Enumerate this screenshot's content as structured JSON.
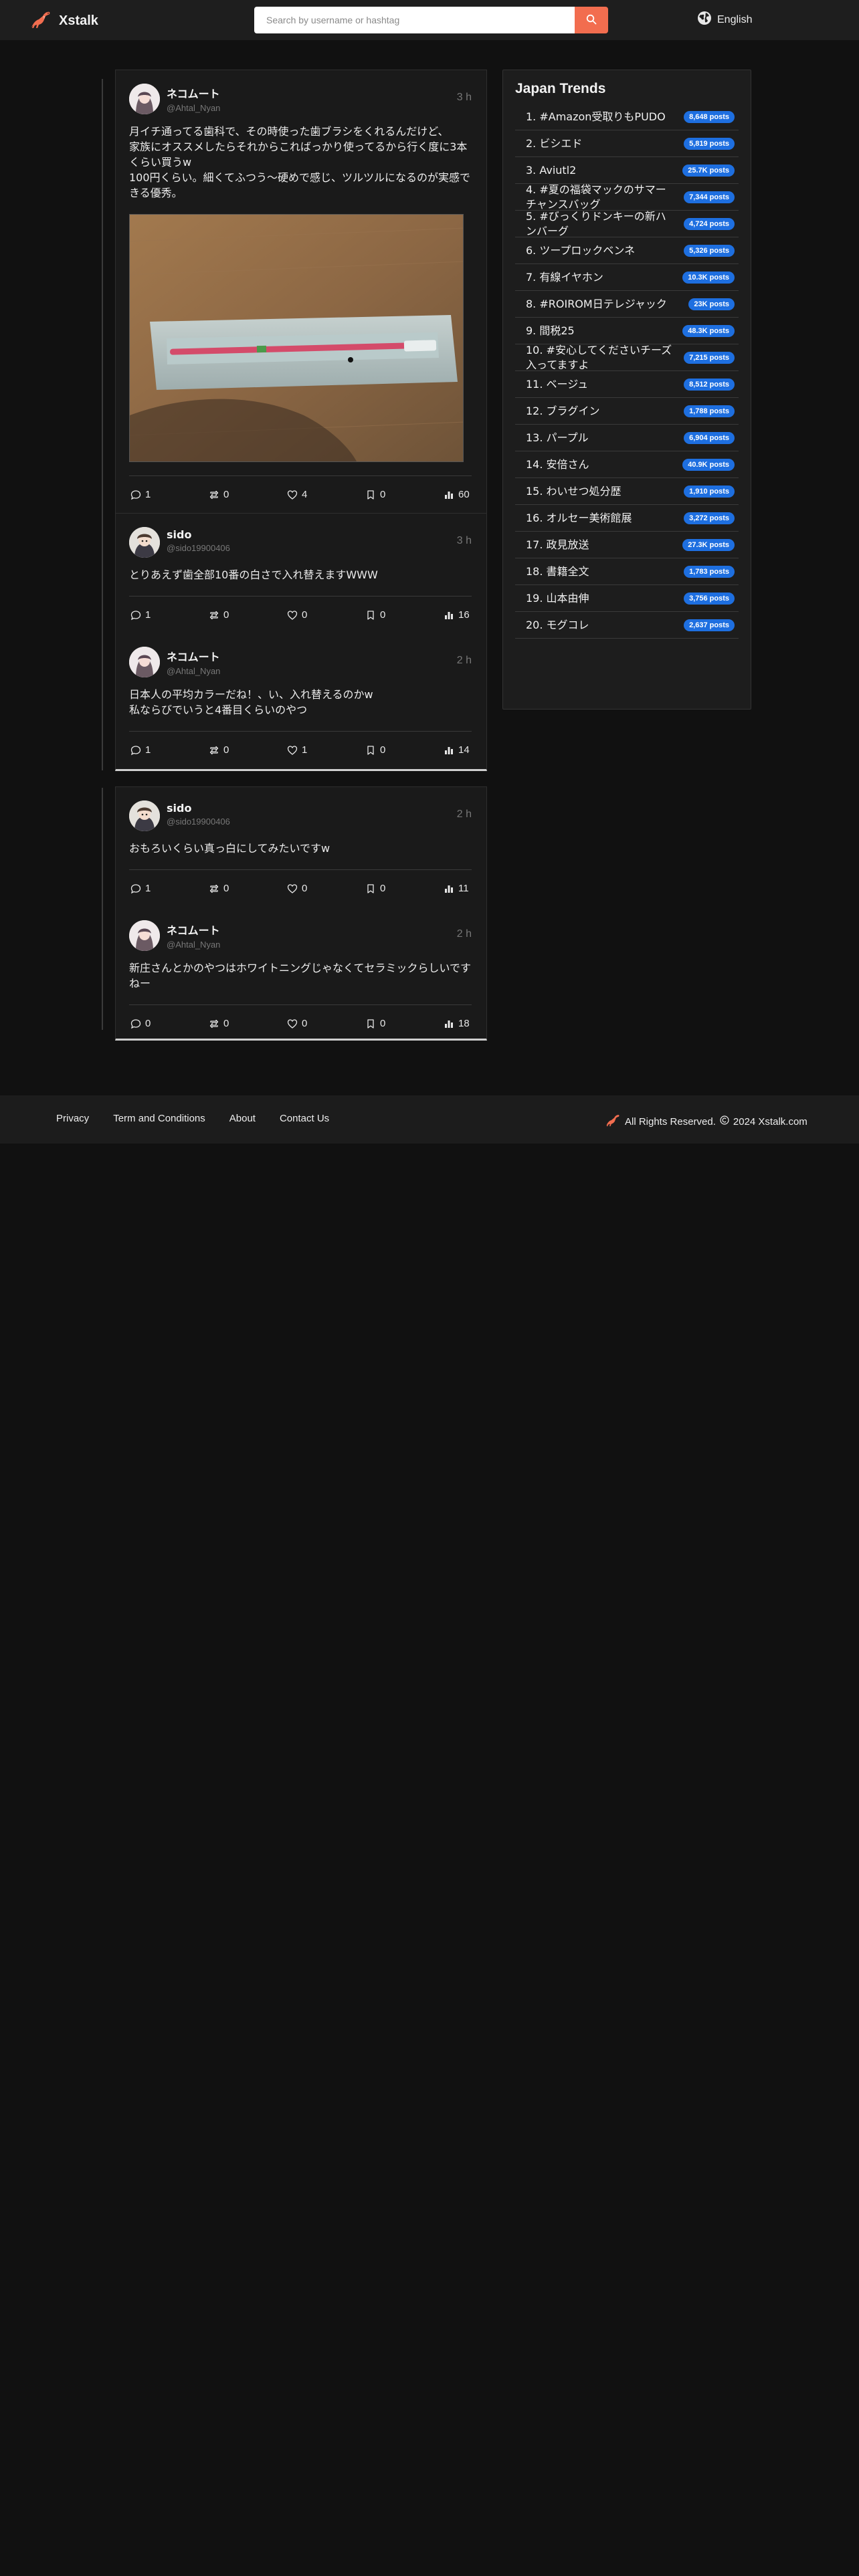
{
  "header": {
    "brand": "Xstalk",
    "search_placeholder": "Search by username or hashtag",
    "language": "English"
  },
  "threads": [
    {
      "posts": [
        {
          "name": "ネコムート",
          "handle": "@Ahtal_Nyan",
          "time": "3 h",
          "text": "月イチ通ってる歯科で、その時使った歯ブラシをくれるんだけど、\n家族にオススメしたらそれからこればっかり使ってるから行く度に3本くらい買うw\n100円くらい。細くてふつう〜硬めで感じ、ツルツルになるのが実感できる優秀。",
          "has_image": true,
          "comments": "1",
          "reposts": "0",
          "likes": "4",
          "bookmarks": "0",
          "views": "60"
        },
        {
          "name": "sido",
          "handle": "@sido19900406",
          "time": "3 h",
          "text": "とりあえず歯全部10番の白さで入れ替えますWWW",
          "has_image": false,
          "comments": "1",
          "reposts": "0",
          "likes": "0",
          "bookmarks": "0",
          "views": "16"
        },
        {
          "name": "ネコムート",
          "handle": "@Ahtal_Nyan",
          "time": "2 h",
          "text": "日本人の平均カラーだね！、い、入れ替えるのかw\n私ならびでいうと4番目くらいのやつ",
          "has_image": false,
          "comments": "1",
          "reposts": "0",
          "likes": "1",
          "bookmarks": "0",
          "views": "14"
        }
      ]
    },
    {
      "posts": [
        {
          "name": "sido",
          "handle": "@sido19900406",
          "time": "2 h",
          "text": "おもろいくらい真っ白にしてみたいですw",
          "has_image": false,
          "comments": "1",
          "reposts": "0",
          "likes": "0",
          "bookmarks": "0",
          "views": "11"
        },
        {
          "name": "ネコムート",
          "handle": "@Ahtal_Nyan",
          "time": "2 h",
          "text": "新庄さんとかのやつはホワイトニングじゃなくてセラミックらしいですねー",
          "has_image": false,
          "comments": "0",
          "reposts": "0",
          "likes": "0",
          "bookmarks": "0",
          "views": "18"
        }
      ]
    }
  ],
  "trends": {
    "title": "Japan Trends",
    "items": [
      {
        "label": "1. #Amazon受取りもPUDO",
        "count": "8,648 posts"
      },
      {
        "label": "2. ビシエド",
        "count": "5,819 posts"
      },
      {
        "label": "3. Aviutl2",
        "count": "25.7K posts"
      },
      {
        "label": "4. #夏の福袋マックのサマーチャンスバッグ",
        "count": "7,344 posts"
      },
      {
        "label": "5. #びっくりドンキーの新ハンバーグ",
        "count": "4,724 posts"
      },
      {
        "label": "6. ツープロックベンネ",
        "count": "5,326 posts"
      },
      {
        "label": "7. 有線イヤホン",
        "count": "10.3K posts"
      },
      {
        "label": "8. #ROIROM日テレジャック",
        "count": "23K posts"
      },
      {
        "label": "9. 間税25",
        "count": "48.3K posts"
      },
      {
        "label": "10. #安心してくださいチーズ入ってますよ",
        "count": "7,215 posts"
      },
      {
        "label": "11. ベージュ",
        "count": "8,512 posts"
      },
      {
        "label": "12. ブラグイン",
        "count": "1,788 posts"
      },
      {
        "label": "13. パープル",
        "count": "6,904 posts"
      },
      {
        "label": "14. 安倍さん",
        "count": "40.9K posts"
      },
      {
        "label": "15. わいせつ処分歴",
        "count": "1,910 posts"
      },
      {
        "label": "16. オルセー美術館展",
        "count": "3,272 posts"
      },
      {
        "label": "17. 政見放送",
        "count": "27.3K posts"
      },
      {
        "label": "18. 書籍全文",
        "count": "1,783 posts"
      },
      {
        "label": "19. 山本由伸",
        "count": "3,756 posts"
      },
      {
        "label": "20. モグコレ",
        "count": "2,637 posts"
      }
    ]
  },
  "footer": {
    "links": [
      "Privacy",
      "Term and Conditions",
      "About",
      "Contact Us"
    ],
    "rights": "All Rights Reserved.",
    "copyright": "2024 Xstalk.com"
  },
  "colors": {
    "accent": "#f26d4f",
    "badge": "#1e6fe0",
    "background": "#111111",
    "card": "#1a1a1a"
  }
}
